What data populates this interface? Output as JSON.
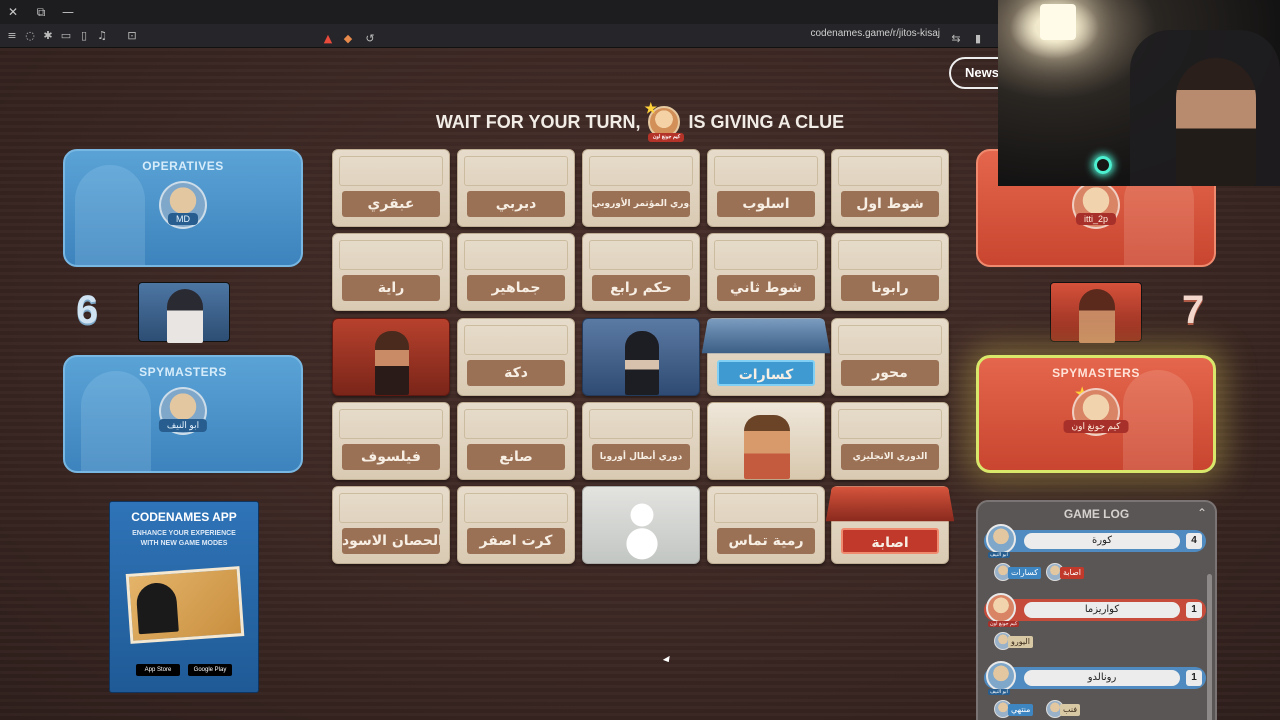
{
  "browser": {
    "url": "codenames.game/r/jitos-kisaj",
    "window_buttons": [
      "✕",
      "⧉",
      "—"
    ]
  },
  "header": {
    "news_label": "News",
    "headline_left": "WAIT FOR YOUR TURN,",
    "headline_right": "IS GIVING A CLUE",
    "current_clue_giver": "كيم جونغ اون"
  },
  "blue_team": {
    "operatives_title": "OPERATIVES",
    "operative_name": "MD",
    "score": "6",
    "spymasters_title": "SPYMASTERS",
    "spymaster_name": "ابو النيف",
    "color": "#3d83bd"
  },
  "red_team": {
    "operative_name": "itti_2p",
    "score": "7",
    "spymasters_title": "SPYMASTERS",
    "spymaster_name": "كيم جونغ اون",
    "color": "#c9452f"
  },
  "board": [
    {
      "word": "عبقري",
      "state": "hidden"
    },
    {
      "word": "ديربي",
      "state": "hidden"
    },
    {
      "word": "دوري المؤتمر الأوروبي",
      "state": "hidden"
    },
    {
      "word": "اسلوب",
      "state": "hidden"
    },
    {
      "word": "شوط اول",
      "state": "hidden"
    },
    {
      "word": "راية",
      "state": "hidden"
    },
    {
      "word": "جماهير",
      "state": "hidden"
    },
    {
      "word": "حكم رابع",
      "state": "hidden"
    },
    {
      "word": "شوط ثاني",
      "state": "hidden"
    },
    {
      "word": "رابونا",
      "state": "hidden"
    },
    {
      "word": "",
      "state": "red"
    },
    {
      "word": "دكة",
      "state": "hidden"
    },
    {
      "word": "",
      "state": "blue"
    },
    {
      "word": "كسارات",
      "state": "half-blue"
    },
    {
      "word": "محور",
      "state": "hidden"
    },
    {
      "word": "فيلسوف",
      "state": "hidden"
    },
    {
      "word": "صانع",
      "state": "hidden"
    },
    {
      "word": "دوري أبطال أوروبا",
      "state": "hidden"
    },
    {
      "word": "",
      "state": "neutral"
    },
    {
      "word": "الدوري الانجليزي",
      "state": "hidden"
    },
    {
      "word": "الحصان الاسود",
      "state": "hidden"
    },
    {
      "word": "كرت اصفر",
      "state": "hidden"
    },
    {
      "word": "",
      "state": "neutral2"
    },
    {
      "word": "رمية تماس",
      "state": "hidden"
    },
    {
      "word": "اصابة",
      "state": "half-red"
    }
  ],
  "app_ad": {
    "title": "CODENAMES APP",
    "subtitle_line1": "ENHANCE YOUR EXPERIENCE",
    "subtitle_line2": "WITH NEW GAME MODES",
    "app_store": "App Store",
    "google_play": "Google Play"
  },
  "game_log": {
    "title": "GAME LOG",
    "entries": [
      {
        "team": "blue",
        "clue": "كورة",
        "number": "4",
        "giver": "ابو النيف",
        "guesses": [
          {
            "word": "كسارات",
            "type": "blue"
          },
          {
            "word": "اصابة",
            "type": "red"
          }
        ]
      },
      {
        "team": "red",
        "clue": "كواريزما",
        "number": "1",
        "giver": "كيم جونغ اون",
        "guesses": [
          {
            "word": "اليورو",
            "type": "neutral"
          }
        ]
      },
      {
        "team": "blue",
        "clue": "رونالدو",
        "number": "1",
        "giver": "ابو النيف",
        "guesses": [
          {
            "word": "منتهي",
            "type": "blue"
          },
          {
            "word": "فنب",
            "type": "neutral"
          }
        ]
      }
    ]
  }
}
